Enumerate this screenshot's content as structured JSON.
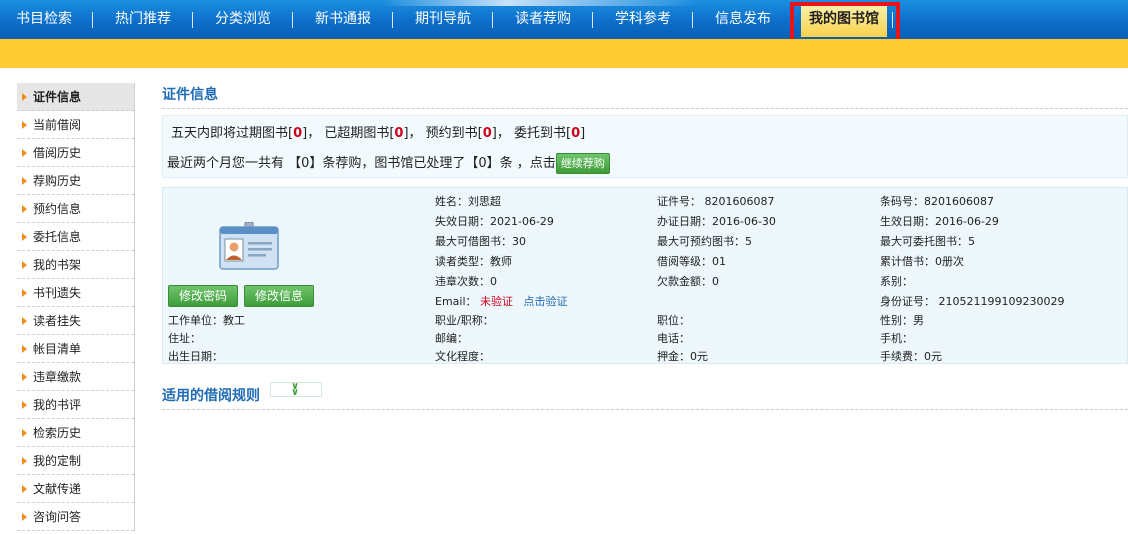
{
  "nav": {
    "items": [
      "书目检索",
      "热门推荐",
      "分类浏览",
      "新书通报",
      "期刊导航",
      "读者荐购",
      "学科参考",
      "信息发布"
    ],
    "active": "我的图书馆"
  },
  "sidebar": {
    "items": [
      "证件信息",
      "当前借阅",
      "借阅历史",
      "荐购历史",
      "预约信息",
      "委托信息",
      "我的书架",
      "书刊遗失",
      "读者挂失",
      "帐目清单",
      "违章缴款",
      "我的书评",
      "检索历史",
      "我的定制",
      "文献传递",
      "咨询问答"
    ]
  },
  "main": {
    "title": "证件信息",
    "notice": {
      "p1": "五天内即将过期图书[",
      "c1": "0",
      "p2": "]， 已超期图书[",
      "c2": "0",
      "p3": "]， 预约到书[",
      "c3": "0",
      "p4": "]，   委托到书[",
      "c4": "0",
      "p5": "]",
      "line2_a": "最近两个月您一共有 【0】条荐购，图书馆已处理了【0】条 ，点击",
      "continue_btn": "继续荐购"
    },
    "buttons": {
      "change_password": "修改密码",
      "edit_info": "修改信息"
    },
    "info": {
      "name": "姓名：刘思超",
      "card_no": "证件号：  8201606087",
      "barcode": "条码号：8201606087",
      "expire": "失效日期：2021-06-29",
      "issue": "办证日期：2016-06-30",
      "effective": "生效日期：2016-06-29",
      "max_borrow": "最大可借图书：30",
      "max_reserve": "最大可预约图书：5",
      "max_entrust": "最大可委托图书：5",
      "reader_type": "读者类型：教师",
      "borrow_level": "借阅等级：01",
      "total_borrow": "累计借书：0册次",
      "violations": "违章次数：0",
      "debt": "欠款金额：0",
      "department": "系别：",
      "email_label": "Email：",
      "email_status": "未验证",
      "email_verify": "点击验证",
      "id_number": "身份证号：  210521199109230029",
      "workplace": "工作单位：教工",
      "job_title": "职业/职称：",
      "position": "职位：",
      "gender": "性别：男",
      "address": "住址：",
      "postcode": "邮编：",
      "phone": "电话：",
      "mobile": "手机：",
      "birthday": "出生日期：",
      "education": "文化程度：",
      "deposit": "押金：0元",
      "fee": "手续费：0元"
    },
    "rules_title": "适用的借阅规则"
  },
  "colors": {
    "nav_blue": "#0c6cc8",
    "yellow_bar": "#ffcc33",
    "title_blue": "#1f6bb5",
    "highlight_red": "#e8141c",
    "button_green": "#4aa845"
  }
}
